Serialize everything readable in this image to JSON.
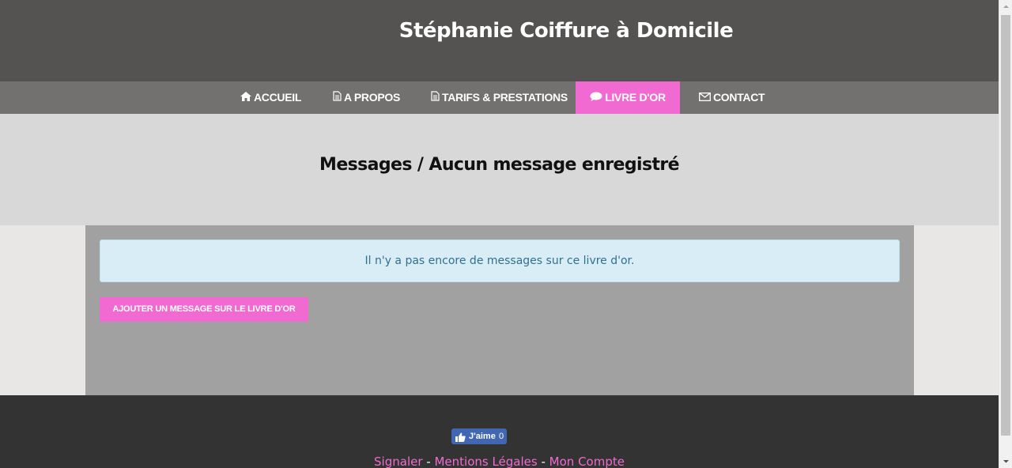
{
  "header": {
    "site_title": "Stéphanie Coiffure à Domicile"
  },
  "nav": {
    "items": [
      {
        "label": "ACCUEIL",
        "icon": "home-icon"
      },
      {
        "label": "A PROPOS",
        "icon": "document-icon"
      },
      {
        "label": "TARIFS & PRESTATIONS",
        "icon": "document-icon"
      },
      {
        "label": "LIVRE D'OR",
        "icon": "speech-bubble-icon",
        "active": true
      },
      {
        "label": "CONTACT",
        "icon": "envelope-icon"
      }
    ]
  },
  "main": {
    "title": "Messages / Aucun message enregistré",
    "alert_text": "Il n'y a pas encore de messages sur ce livre d'or.",
    "add_button_label": "AJOUTER UN MESSAGE SUR LE LIVRE D'OR"
  },
  "footer": {
    "like_label": "J'aime",
    "like_count": "0",
    "links": [
      "Signaler",
      "Mentions Légales",
      "Mon Compte"
    ],
    "separator": " - "
  },
  "colors": {
    "accent": "#f06ad1",
    "header_bg": "#545352",
    "nav_bg": "#727170",
    "footer_bg": "#333333"
  }
}
